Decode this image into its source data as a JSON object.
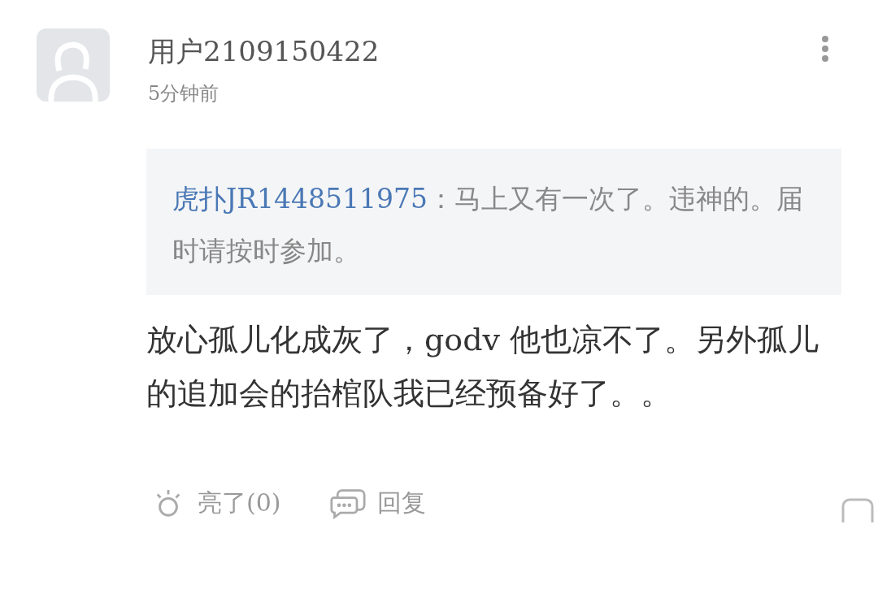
{
  "comment": {
    "author": "用户2109150422",
    "time": "5分钟前",
    "quote": {
      "author": "虎扑JR1448511975",
      "separator": "：",
      "text": "马上又有一次了。违神的。届时请按时参加。"
    },
    "body": "放心孤儿化成灰了，godv 他也凉不了。另外孤儿的追加会的抬棺队我已经预备好了。。",
    "actions": [
      {
        "kind": "like",
        "label": "亮了(0)"
      },
      {
        "kind": "reply",
        "label": "回复"
      }
    ]
  }
}
